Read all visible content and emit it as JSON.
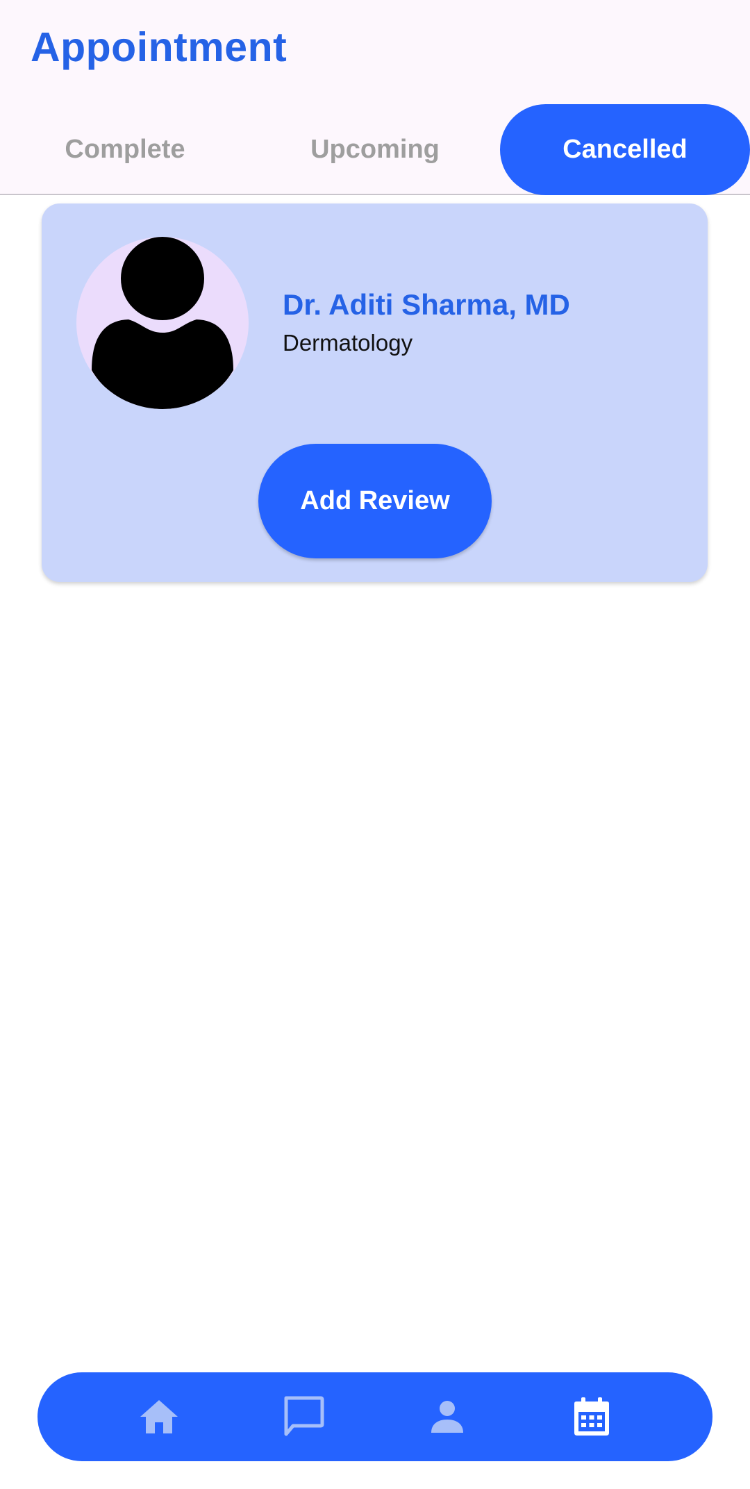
{
  "header": {
    "title": "Appointment"
  },
  "tabs": [
    {
      "label": "Complete",
      "selected": false
    },
    {
      "label": "Upcoming",
      "selected": false
    },
    {
      "label": "Cancelled",
      "selected": true
    }
  ],
  "appointment_card": {
    "doctor_name": "Dr. Aditi Sharma, MD",
    "specialty": "Dermatology",
    "avatar_icon": "person-placeholder-icon",
    "review_button_label": "Add Review"
  },
  "bottom_nav": {
    "items": [
      {
        "icon": "home-icon",
        "active": false
      },
      {
        "icon": "chat-icon",
        "active": false
      },
      {
        "icon": "person-icon",
        "active": false
      },
      {
        "icon": "calendar-icon",
        "active": true
      }
    ]
  },
  "colors": {
    "primary": "#2563ff",
    "title_text": "#2562e6",
    "card_background": "#c9d5fb",
    "avatar_background": "#ebdcfc",
    "inactive_tab_text": "#9e9e9e",
    "inactive_nav_icon": "#a7bff9",
    "header_background": "#fdf7fd"
  }
}
